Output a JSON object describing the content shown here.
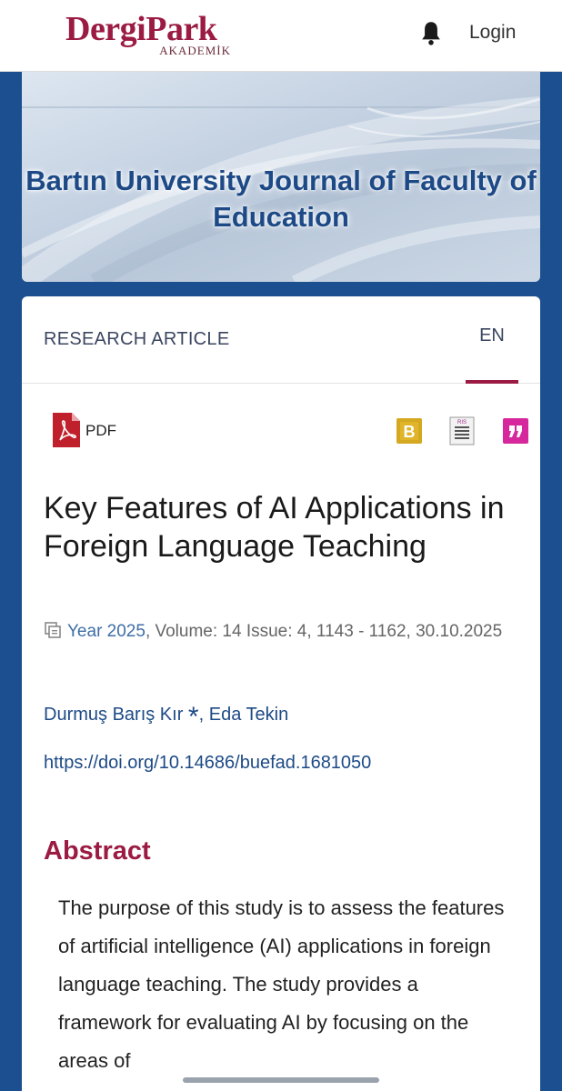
{
  "header": {
    "logo_main": "DergiPark",
    "logo_sub": "AKADEMİK",
    "login_label": "Login"
  },
  "banner": {
    "journal_title": "Bartın University Journal of Faculty of Education"
  },
  "tabs": {
    "article_type": "RESEARCH ARTICLE",
    "language": "EN"
  },
  "tools": {
    "pdf_label": "PDF",
    "bibtex_icon": "B",
    "ris_icon": "RIS",
    "cite_icon": "99"
  },
  "article": {
    "title": "Key Features of AI Applications in Foreign Language Teaching",
    "year_link": "Year 2025",
    "meta_rest": ", Volume: 14 Issue: 4, 1143 - 1162, 30.10.2025",
    "author_1": "Durmuş Barış Kır",
    "author_mark": "*",
    "author_sep": ", ",
    "author_2": "Eda Tekin",
    "doi": "https://doi.org/10.14686/buefad.1681050"
  },
  "abstract": {
    "heading": "Abstract",
    "text": "The purpose of this study is to assess the features of artificial intelligence (AI) applications in foreign language teaching. The study provides a framework for evaluating AI by focusing on the areas of"
  },
  "colors": {
    "brand": "#9b1b42",
    "link": "#1d4a86",
    "page_bg": "#1b4f8f"
  }
}
